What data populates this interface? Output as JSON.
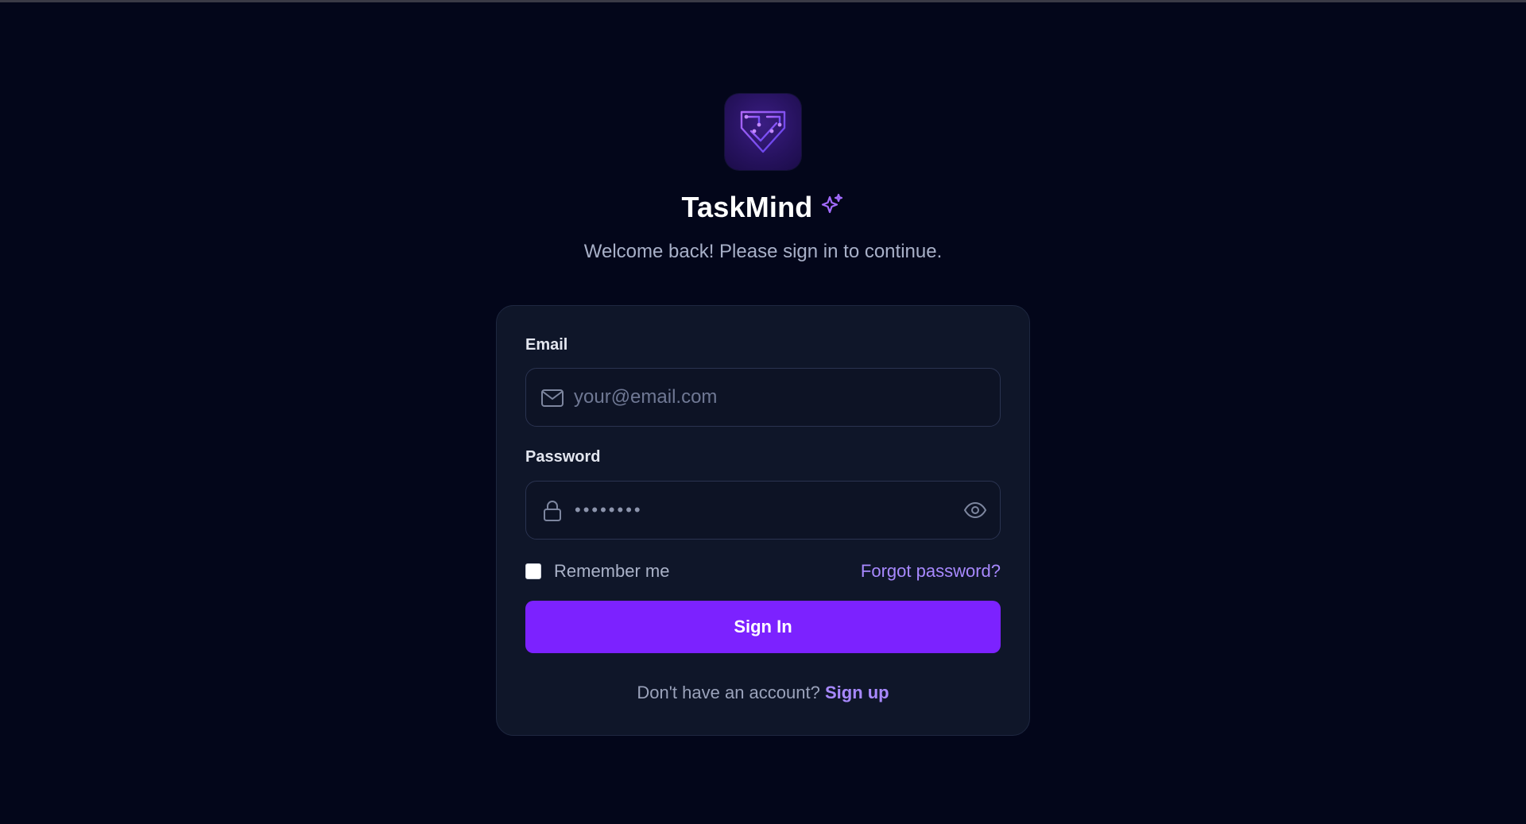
{
  "app": {
    "name": "TaskMind",
    "subtitle": "Welcome back! Please sign in to continue."
  },
  "form": {
    "email_label": "Email",
    "email_placeholder": "your@email.com",
    "password_label": "Password",
    "password_masked": "••••••••",
    "remember_label": "Remember me",
    "remember_checked": false,
    "forgot_label": "Forgot password?",
    "submit_label": "Sign In",
    "signup_prompt": "Don't have an account?",
    "signup_link": "Sign up"
  },
  "icons": {
    "logo": "circuit-shield-check-logo",
    "sparkle": "sparkle-icon",
    "email": "mail-icon",
    "password": "lock-icon",
    "toggle_visibility": "eye-icon"
  },
  "colors": {
    "background": "#03061a",
    "card": "#0f1629",
    "accent": "#7c22ff",
    "link": "#a889ff"
  }
}
